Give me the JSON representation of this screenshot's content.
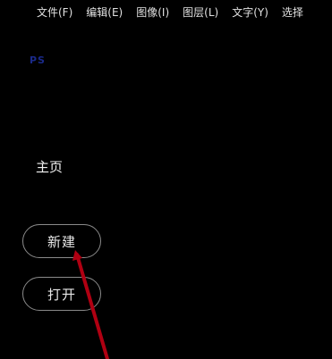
{
  "menubar": {
    "items": [
      {
        "label": "文件(F)"
      },
      {
        "label": "编辑(E)"
      },
      {
        "label": "图像(I)"
      },
      {
        "label": "图层(L)"
      },
      {
        "label": "文字(Y)"
      },
      {
        "label": "选择"
      }
    ]
  },
  "app": {
    "logo_text": "PS"
  },
  "home": {
    "title": "主页",
    "new_label": "新建",
    "open_label": "打开"
  },
  "colors": {
    "background": "#000000",
    "logo": "#1a2a8a",
    "button_border": "#8a8a8a",
    "pointer": "#b00012"
  }
}
